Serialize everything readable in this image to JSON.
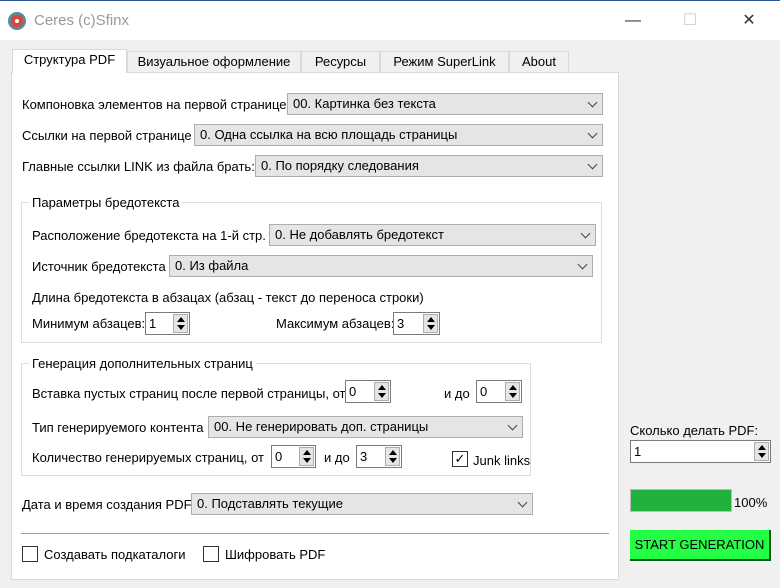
{
  "window": {
    "title": "Ceres (c)Sfinx",
    "minimize": "—",
    "maximize": "☐",
    "close": "✕"
  },
  "tabs": [
    {
      "label": "Структура PDF"
    },
    {
      "label": "Визуальное оформление"
    },
    {
      "label": "Ресурсы"
    },
    {
      "label": "Режим SuperLink"
    },
    {
      "label": "About"
    }
  ],
  "structure": {
    "layout_label": "Компоновка элементов на первой странице",
    "layout_value": "00. Картинка без текста",
    "links_label": "Ссылки на первой странице",
    "links_value": "0. Одна ссылка на всю площадь страницы",
    "mainlinks_label": "Главные ссылки LINK из файла брать:",
    "mainlinks_value": "0. По порядку следования",
    "filler": {
      "title": "Параметры бредотекста",
      "position_label": "Расположение бредотекста на 1-й стр.",
      "position_value": "0. Не добавлять бредотекст",
      "source_label": "Источник бредотекста",
      "source_value": "0. Из файла",
      "length_note": "Длина бредотекста в абзацах (абзац - текст до переноса строки)",
      "min_label": "Минимум абзацев:",
      "min_value": "1",
      "max_label": "Максимум абзацев:",
      "max_value": "3"
    },
    "extra": {
      "title": "Генерация дополнительных страниц",
      "blank_label": "Вставка пустых страниц после первой страницы, от",
      "blank_from": "0",
      "blank_to_label": "и до",
      "blank_to": "0",
      "type_label": "Тип генерируемого контента",
      "type_value": "00. Не генерировать доп. страницы",
      "count_label": "Количество генерируемых страниц, от",
      "count_from": "0",
      "count_to_label": "и до",
      "count_to": "3",
      "junk_label": "Junk links",
      "junk_checked": true
    },
    "date_label": "Дата и время создания PDF",
    "date_value": "0. Подставлять текущие",
    "subdirs_label": "Создавать подкаталоги",
    "encrypt_label": "Шифровать PDF"
  },
  "side": {
    "count_label": "Сколько делать PDF:",
    "count_value": "1",
    "progress_percent": 100,
    "progress_text": "100%",
    "start_label": "START GENERATION"
  },
  "check_mark": "✓"
}
